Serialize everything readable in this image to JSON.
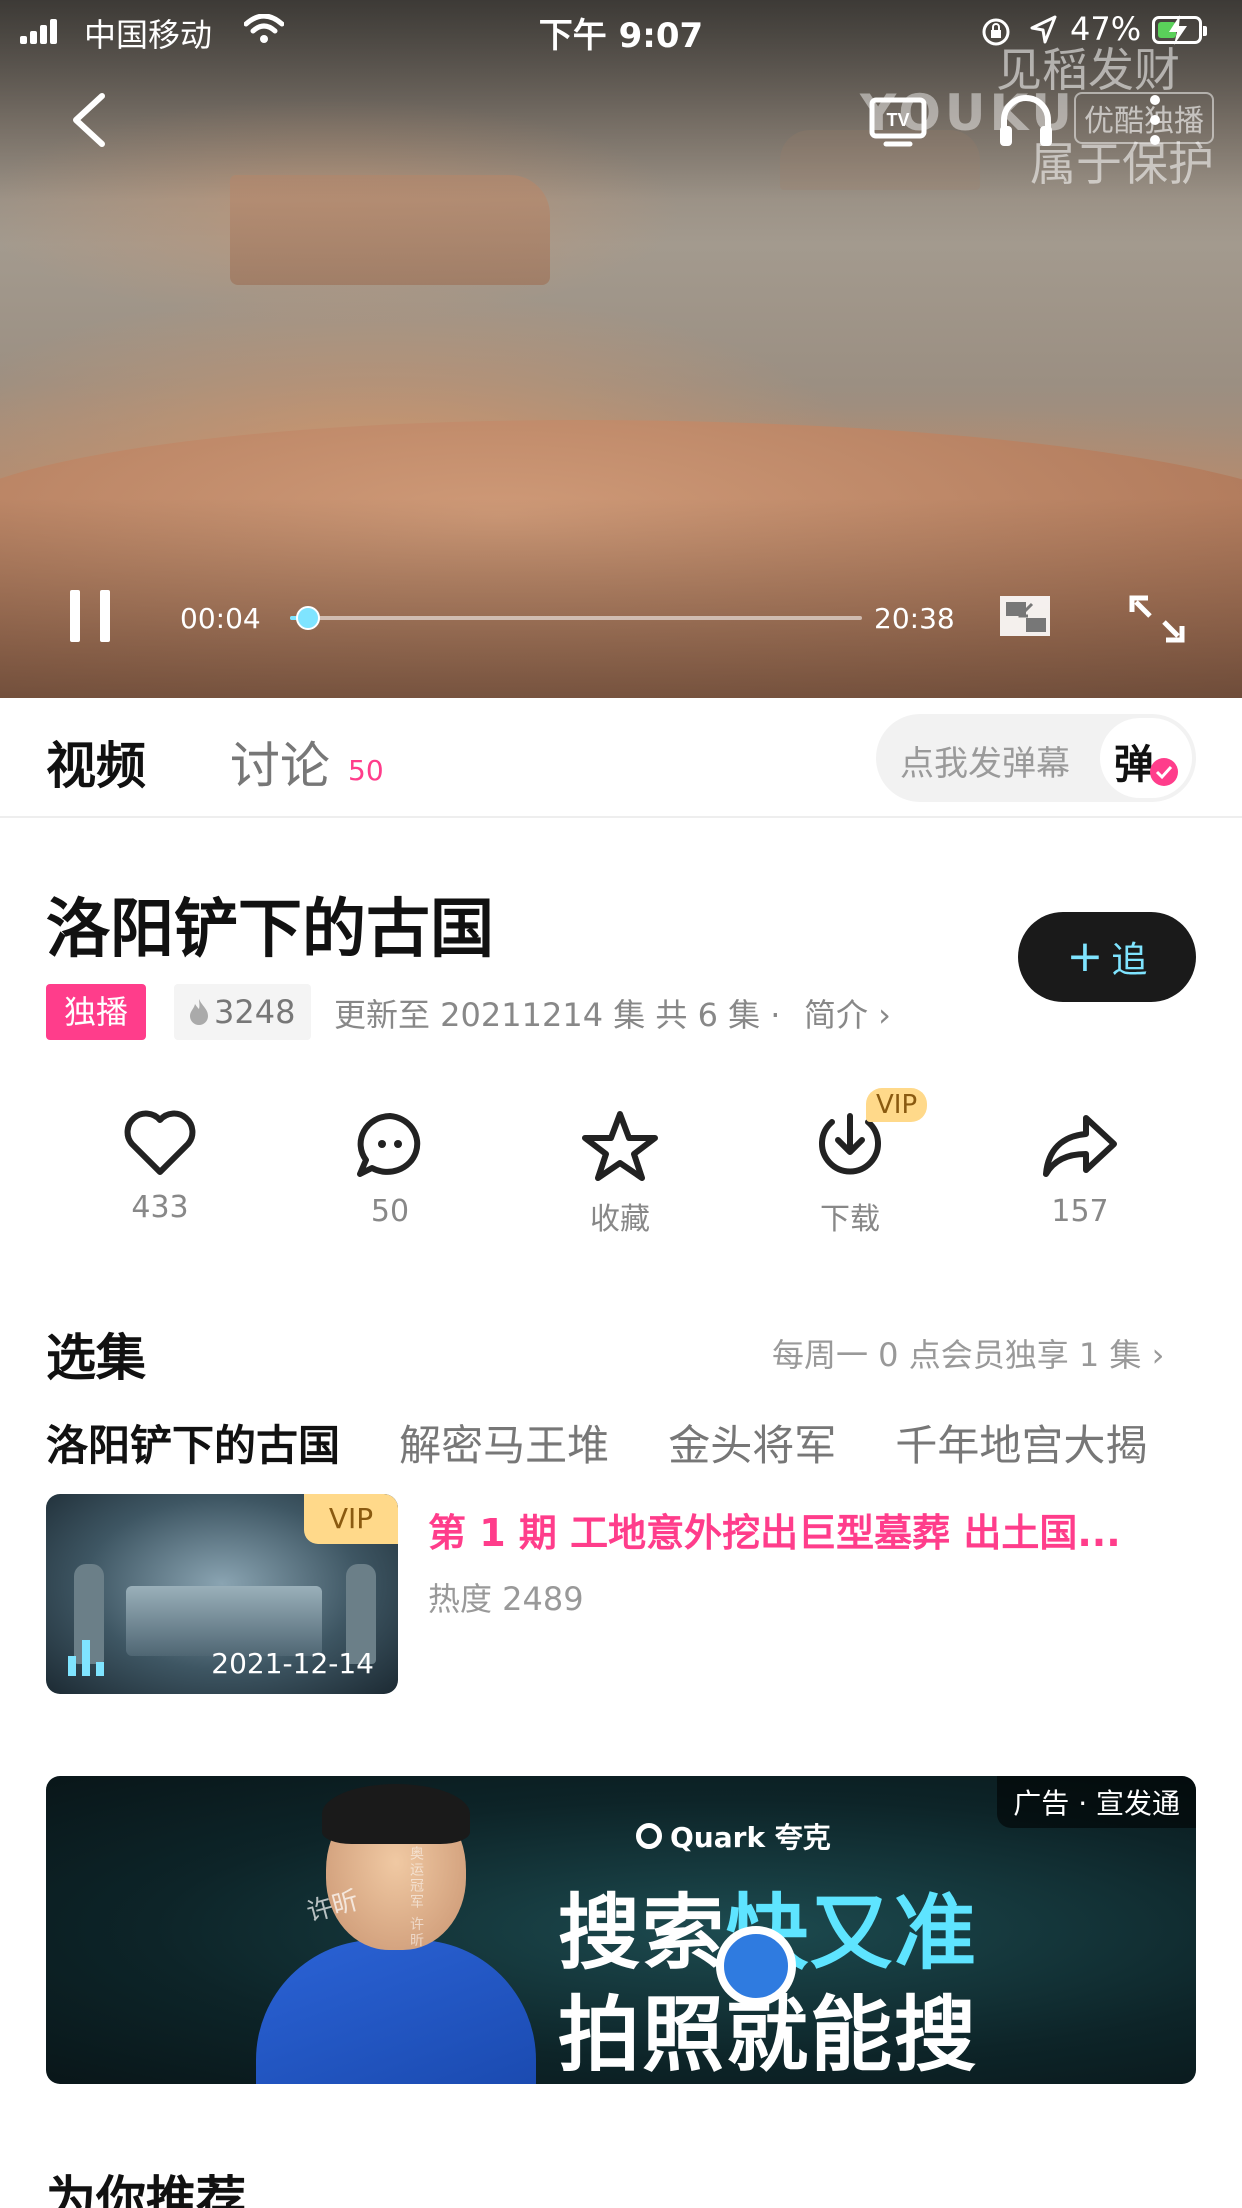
{
  "status_bar": {
    "carrier": "中国移动",
    "time": "下午 9:07",
    "battery_pct": "47%",
    "battery_level": 0.47
  },
  "player": {
    "watermark_line1": "见稻发财",
    "watermark_logo": "YOUKU",
    "watermark_badge": "优酷独播",
    "watermark_line3": "属于保护",
    "current_time": "00:04",
    "total_time": "20:38",
    "progress": 0.0032,
    "icons": [
      "back-icon",
      "tv-icon",
      "headphone-icon",
      "more-icon",
      "pause-icon",
      "pip-icon",
      "fullscreen-icon"
    ]
  },
  "tabs": {
    "video_label": "视频",
    "discuss_label": "讨论",
    "discuss_count": "50",
    "danmaku_placeholder": "点我发弹幕",
    "danmaku_button": "弹"
  },
  "show": {
    "title": "洛阳铲下的古国",
    "follow_plus": "+",
    "follow_label": "追",
    "exclusive_badge": "独播",
    "heat": "3248",
    "update_info": "更新至 20211214 集 共 6 集 ·",
    "intro_label": "简介 ›"
  },
  "actions": [
    {
      "icon": "heart-icon",
      "label": "433"
    },
    {
      "icon": "comment-icon",
      "label": "50"
    },
    {
      "icon": "star-icon",
      "label": "收藏"
    },
    {
      "icon": "download-icon",
      "label": "下载",
      "tag": "VIP"
    },
    {
      "icon": "share-icon",
      "label": "157"
    }
  ],
  "episodes_section": {
    "title": "选集",
    "note": "每周一 0 点会员独享 1 集 ›",
    "series": [
      "洛阳铲下的古国",
      "解密马王堆",
      "金头将军",
      "千年地宫大揭"
    ],
    "episode": {
      "tag": "VIP",
      "date": "2021-12-14",
      "title": "第 1 期 工地意外挖出巨型墓葬 出土国...",
      "heat": "热度 2489"
    }
  },
  "ad": {
    "tag": "广告 · 宣发通",
    "brand": "Quark 夸克",
    "line1_a": "搜索",
    "line1_b": "快又准",
    "line2": "拍照就能搜",
    "sign": "许昕",
    "sign_small": "奥运冠军 许昕"
  },
  "recommend": {
    "title": "为你推荐"
  },
  "colors": {
    "accent_pink": "#ff3d8b",
    "accent_cyan": "#7fe4ff",
    "vip_gold": "#ffd98a"
  }
}
